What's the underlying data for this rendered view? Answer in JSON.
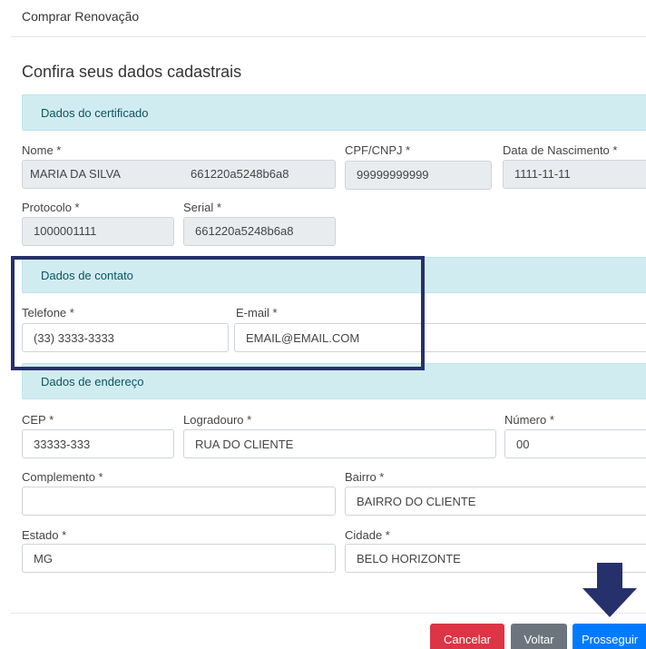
{
  "header": {
    "title": "Comprar Renovação"
  },
  "page": {
    "title": "Confira seus dados cadastrais"
  },
  "certificate": {
    "section_title": "Dados do certificado",
    "nome_label": "Nome *",
    "nome_value": "MARIA DA SILVA",
    "nome_suffix": "661220a5248b6a8",
    "cpf_label": "CPF/CNPJ *",
    "cpf_value": "99999999999",
    "nascimento_label": "Data de Nascimento *",
    "nascimento_value": "1111-11-11",
    "protocolo_label": "Protocolo *",
    "protocolo_value": "1000001111",
    "serial_label": "Serial *",
    "serial_value": "661220a5248b6a8"
  },
  "contact": {
    "section_title": "Dados de contato",
    "telefone_label": "Telefone *",
    "telefone_value": "(33) 3333-3333",
    "email_label": "E-mail *",
    "email_value": "EMAIL@EMAIL.COM"
  },
  "address": {
    "section_title": "Dados de endereço",
    "cep_label": "CEP *",
    "cep_value": "33333-333",
    "logradouro_label": "Logradouro *",
    "logradouro_value": "RUA DO CLIENTE",
    "numero_label": "Número *",
    "numero_value": "00",
    "complemento_label": "Complemento *",
    "complemento_value": "",
    "bairro_label": "Bairro *",
    "bairro_value": "BAIRRO DO CLIENTE",
    "estado_label": "Estado *",
    "estado_value": "MG",
    "cidade_label": "Cidade *",
    "cidade_value": "BELO HORIZONTE"
  },
  "actions": {
    "cancel_label": "Cancelar",
    "back_label": "Voltar",
    "next_label": "Prosseguir"
  },
  "colors": {
    "section_bg": "#d1ecf1",
    "section_text": "#0c5460",
    "highlight": "#26306b",
    "cancel": "#dc3545",
    "back": "#6c757d",
    "next": "#007bff"
  },
  "icons": {
    "pointer_arrow": "arrow-down-icon"
  }
}
